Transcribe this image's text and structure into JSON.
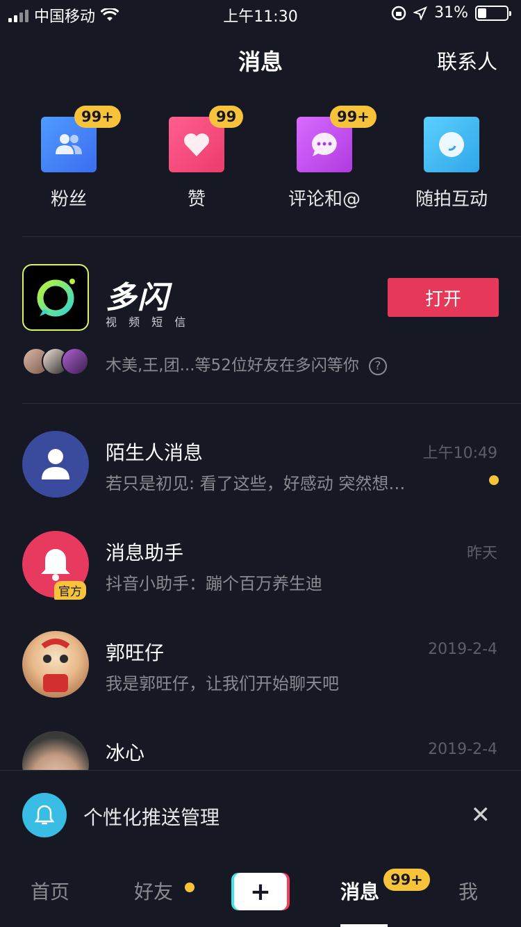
{
  "status_bar": {
    "carrier": "中国移动",
    "time": "上午11:30",
    "battery": "31%",
    "battery_level": 0.31
  },
  "header": {
    "title": "消息",
    "contacts": "联系人"
  },
  "quick_actions": [
    {
      "label": "粉丝",
      "badge": "99+",
      "icon": "fans-icon",
      "color": "#4a8cf7"
    },
    {
      "label": "赞",
      "badge": "99",
      "icon": "heart-icon",
      "color": "#f2497c"
    },
    {
      "label": "评论和@",
      "badge": "99+",
      "icon": "comment-icon",
      "color": "#c04ee6"
    },
    {
      "label": "随拍互动",
      "badge": "",
      "icon": "snap-icon",
      "color": "#3fb8ef"
    }
  ],
  "promo": {
    "app_name": "多闪",
    "app_subtitle": "视 频 短 信",
    "open_label": "打开",
    "friends_text": "木美,王,团...等52位好友在多闪等你",
    "help_glyph": "?"
  },
  "messages": [
    {
      "name": "陌生人消息",
      "preview": "若只是初见: 看了这些，好感动 突然想…",
      "time": "上午10:49",
      "unread": true
    },
    {
      "name": "消息助手",
      "preview": "抖音小助手：蹦个百万养生迪",
      "time": "昨天",
      "tag": "官方"
    },
    {
      "name": "郭旺仔",
      "preview": "我是郭旺仔，让我们开始聊天吧",
      "time": "2019-2-4"
    },
    {
      "name": "冰心",
      "preview": "",
      "time": "2019-2-4"
    }
  ],
  "push_banner": {
    "text": "个性化推送管理",
    "close_glyph": "✕"
  },
  "tab_bar": {
    "home": "首页",
    "friends": "好友",
    "create": "+",
    "messages": "消息",
    "messages_badge": "99+",
    "me": "我"
  },
  "colors": {
    "background": "#161823",
    "accent_red": "#e6395a",
    "badge_yellow": "#f7c33a"
  }
}
